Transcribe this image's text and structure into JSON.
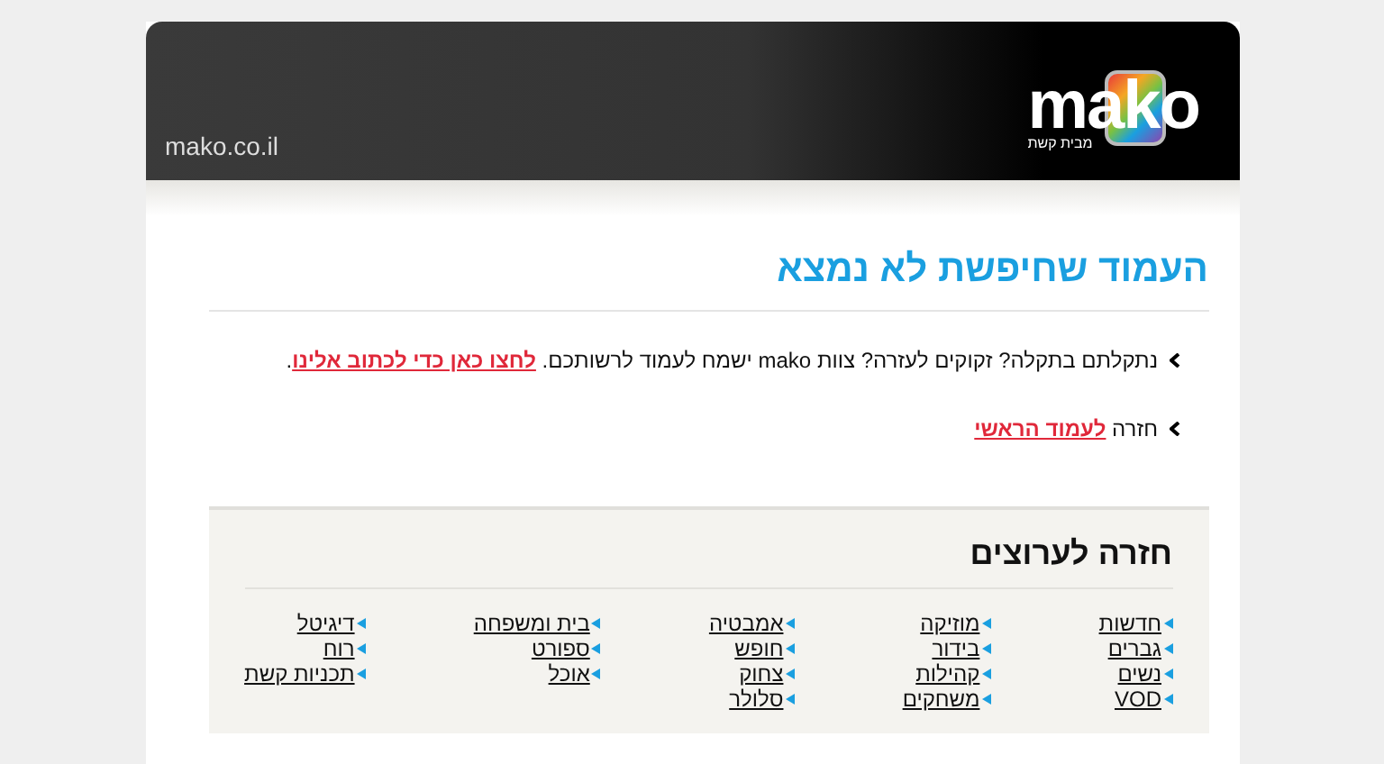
{
  "header": {
    "site_url": "mako.co.il",
    "logo": {
      "name": "mako",
      "tagline": "מבית קשת"
    }
  },
  "title": "העמוד שחיפשת לא נמצא",
  "messages": [
    {
      "text": "נתקלתם בתקלה? זקוקים לעזרה? צוות mako ישמח לעמוד לרשותכם.",
      "link": "לחצו כאן כדי לכתוב אלינו",
      "after": "."
    },
    {
      "text": "חזרה",
      "link": "לעמוד הראשי"
    }
  ],
  "channels": {
    "heading": "חזרה לערוצים",
    "columns": [
      [
        "חדשות",
        "גברים",
        "נשים",
        "VOD"
      ],
      [
        "מוזיקה",
        "בידור",
        "קהילות",
        "משחקים"
      ],
      [
        "אמבטיה",
        "חופש",
        "צחוק",
        "סלולר"
      ],
      [
        "בית ומשפחה",
        "ספורט",
        "אוכל"
      ],
      [
        "דיגיטל",
        "רוח",
        "תכניות קשת"
      ]
    ]
  }
}
